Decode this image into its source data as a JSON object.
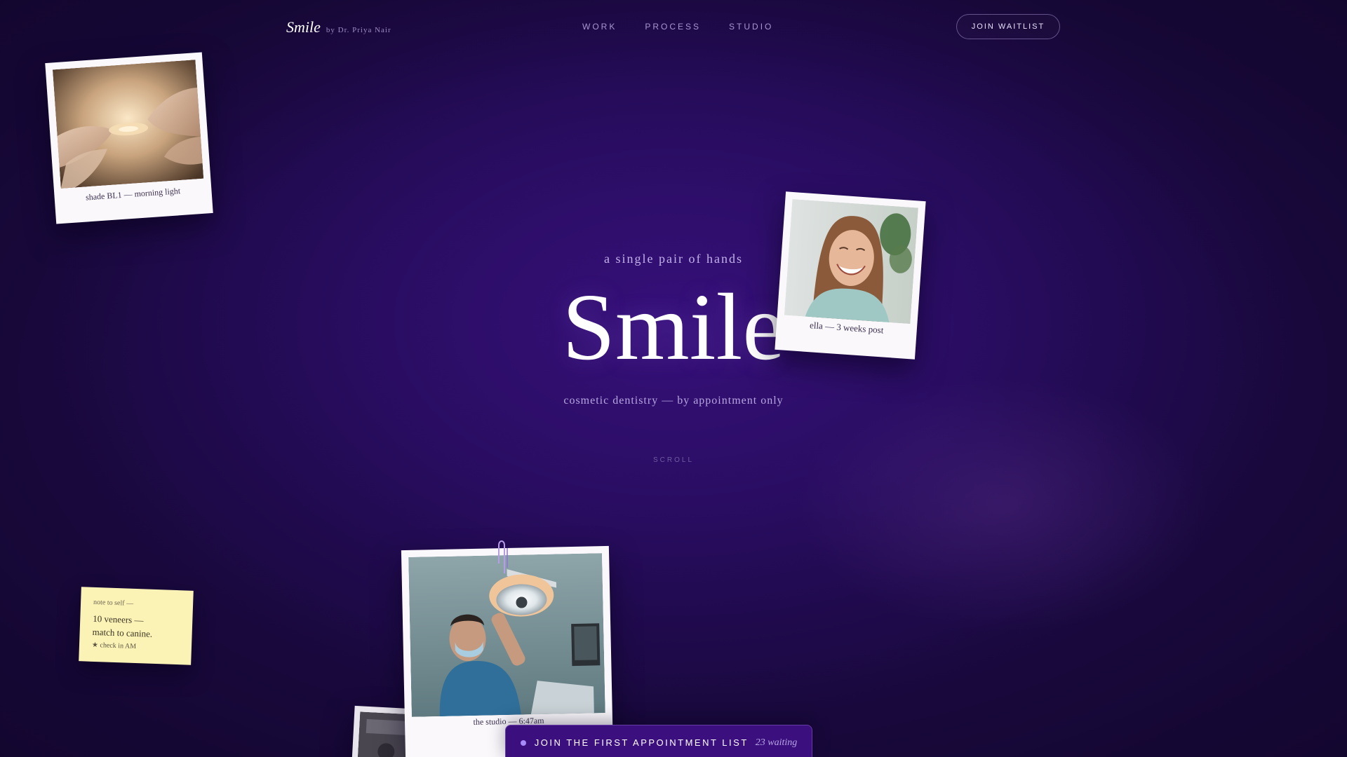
{
  "brand": {
    "name": "Smile",
    "byline": "by Dr. Priya Nair"
  },
  "nav": {
    "links": [
      "WORK",
      "PROCESS",
      "STUDIO"
    ],
    "cta": "JOIN WAITLIST"
  },
  "hero": {
    "eyebrow": "a single pair of hands",
    "title": "Smile",
    "subtitle": "cosmetic dentistry — by appointment only",
    "scroll": "SCROLL"
  },
  "polaroids": [
    {
      "caption": "shade BL1 — morning light",
      "icon": "veneer-photo"
    },
    {
      "caption": "ella — 3 weeks post",
      "icon": "patient-photo"
    },
    {
      "caption": "the studio — 6:47am",
      "icon": "studio-photo"
    }
  ],
  "sticky_note": {
    "heading": "note to self —",
    "lines": [
      "10 veneers —",
      "match to canine."
    ],
    "check": "★ check in AM"
  },
  "appointment_bar": {
    "label": "JOIN THE FIRST APPOINTMENT LIST",
    "count": "23 waiting"
  },
  "colors": {
    "background": "#2a0d63",
    "accent": "#a78bfa",
    "bar": "#3b0f7d",
    "sticky": "#fbf3b6"
  }
}
